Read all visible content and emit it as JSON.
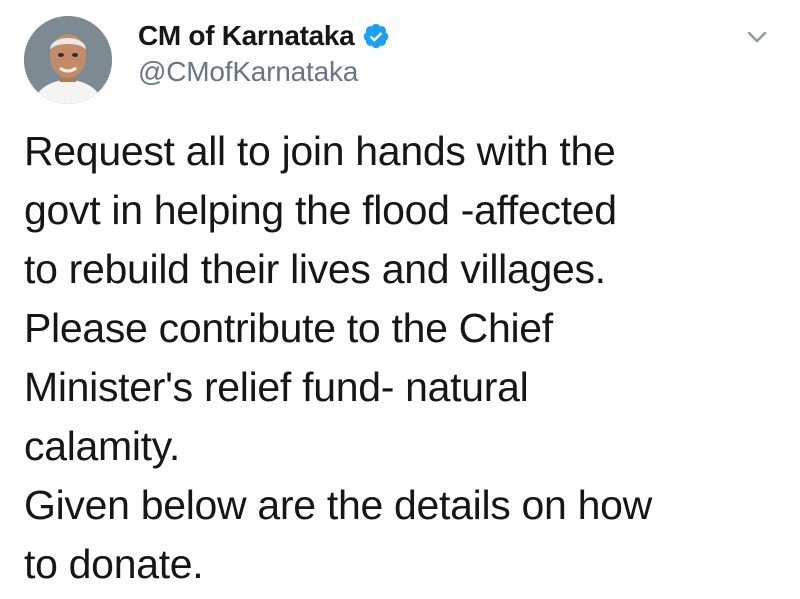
{
  "tweet": {
    "author": {
      "display_name": "CM of Karnataka",
      "handle": "@CMofKarnataka",
      "verified": true
    },
    "text_lines": [
      "Request all to join hands with the",
      "govt in helping the flood -affected",
      "to rebuild their lives and villages.",
      "Please contribute to the Chief",
      "Minister's relief fund- natural",
      "calamity.",
      "Given below are the details on how",
      "to donate."
    ]
  },
  "colors": {
    "text": "#14171a",
    "handle": "#657786",
    "verified": "#1da1f2",
    "caret": "#8899a6"
  },
  "icons": {
    "verified": "verified-badge-icon",
    "menu": "chevron-down-icon"
  }
}
